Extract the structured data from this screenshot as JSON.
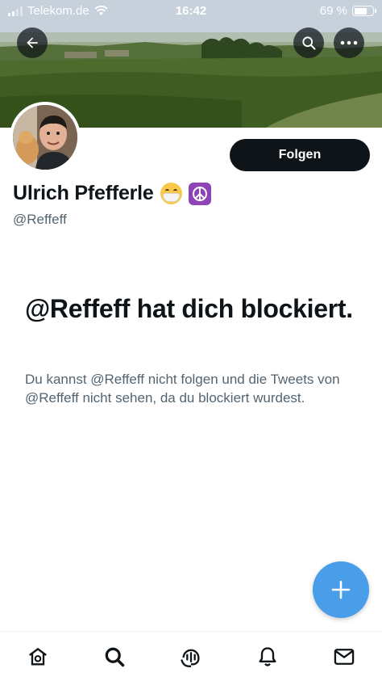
{
  "status_bar": {
    "carrier": "Telekom.de",
    "time": "16:42",
    "battery_percent": "69 %",
    "battery_level": 0.69
  },
  "header": {
    "back_icon": "arrow-left-icon",
    "search_icon": "search-icon",
    "more_icon": "more-horizontal-icon"
  },
  "profile": {
    "display_name": "Ulrich Pfefferle",
    "name_emojis": [
      "face-with-medical-mask",
      "peace-symbol"
    ],
    "handle": "@Reffeff",
    "follow_label": "Folgen"
  },
  "blocked": {
    "title": "@Reffeff hat dich blockiert.",
    "description": "Du kannst @Reffeff nicht folgen und die Tweets von @Reffeff nicht sehen, da du blockiert wurdest."
  },
  "fab": {
    "icon": "plus-icon"
  },
  "bottom_nav": [
    {
      "name": "home",
      "icon": "home-icon"
    },
    {
      "name": "search",
      "icon": "search-icon"
    },
    {
      "name": "spaces",
      "icon": "spaces-icon"
    },
    {
      "name": "notifications",
      "icon": "bell-icon"
    },
    {
      "name": "messages",
      "icon": "envelope-icon"
    }
  ],
  "colors": {
    "text_primary": "#0f1419",
    "text_secondary": "#536471",
    "follow_button_bg": "#0f1419",
    "fab_bg": "#4a9de9"
  }
}
